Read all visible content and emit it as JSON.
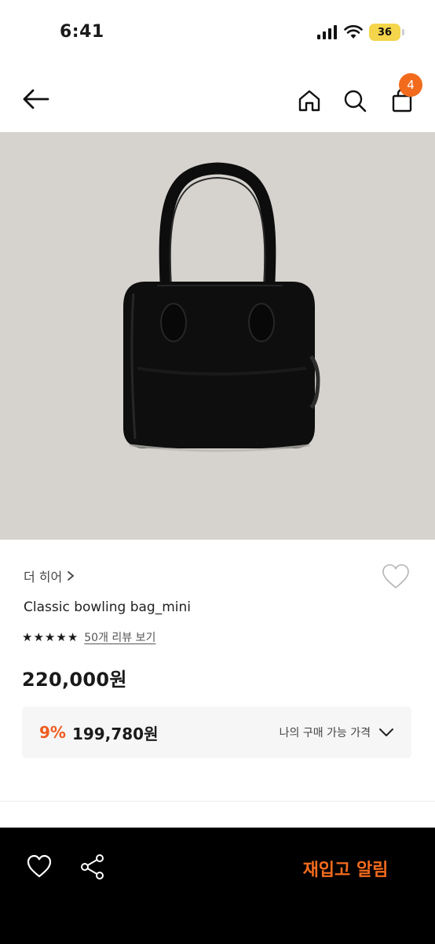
{
  "status_bar": {
    "time": "6:41",
    "battery": "36"
  },
  "nav": {
    "cart_count": "4",
    "icons": [
      "back-arrow-icon",
      "home-icon",
      "search-icon",
      "shopping-bag-icon"
    ]
  },
  "product": {
    "brand": "더 히어",
    "name": "Classic bowling bag_mini",
    "rating_stars": 5,
    "review_link": "50개 리뷰 보기",
    "price": "220,000원",
    "benefit": {
      "discount": "9%",
      "member_price": "199,780원",
      "label": "나의 구매 가능 가격"
    }
  },
  "bottom_bar": {
    "restock_label": "재입고 알림",
    "icons": [
      "heart-icon",
      "share-icon"
    ]
  },
  "colors": {
    "accent": "#f26b1d",
    "image_background": "#d6d3cf",
    "bottom_bar": "#000000"
  }
}
